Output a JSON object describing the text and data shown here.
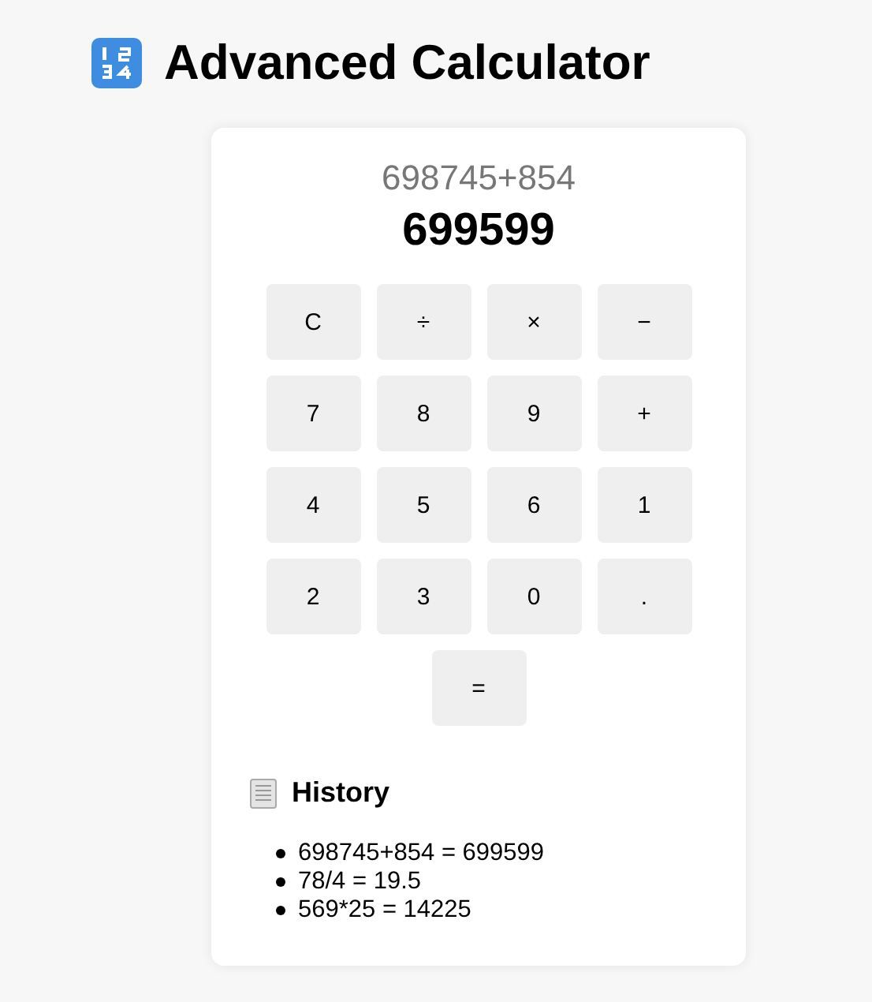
{
  "title": "Advanced Calculator",
  "display": {
    "expression": "698745+854",
    "result": "699599"
  },
  "keys": [
    {
      "label": "C",
      "kind": "key"
    },
    {
      "label": "÷",
      "kind": "key"
    },
    {
      "label": "×",
      "kind": "key"
    },
    {
      "label": "−",
      "kind": "key"
    },
    {
      "label": "7",
      "kind": "key"
    },
    {
      "label": "8",
      "kind": "key"
    },
    {
      "label": "9",
      "kind": "key"
    },
    {
      "label": "+",
      "kind": "key"
    },
    {
      "label": "4",
      "kind": "key"
    },
    {
      "label": "5",
      "kind": "key"
    },
    {
      "label": "6",
      "kind": "key"
    },
    {
      "label": "1",
      "kind": "key"
    },
    {
      "label": "2",
      "kind": "key"
    },
    {
      "label": "3",
      "kind": "key"
    },
    {
      "label": "0",
      "kind": "key"
    },
    {
      "label": ".",
      "kind": "key"
    },
    {
      "label": "=",
      "kind": "equals"
    }
  ],
  "history": {
    "heading": "History",
    "entries": [
      "698745+854 = 699599",
      "78/4 = 19.5",
      "569*25 = 14225"
    ]
  }
}
